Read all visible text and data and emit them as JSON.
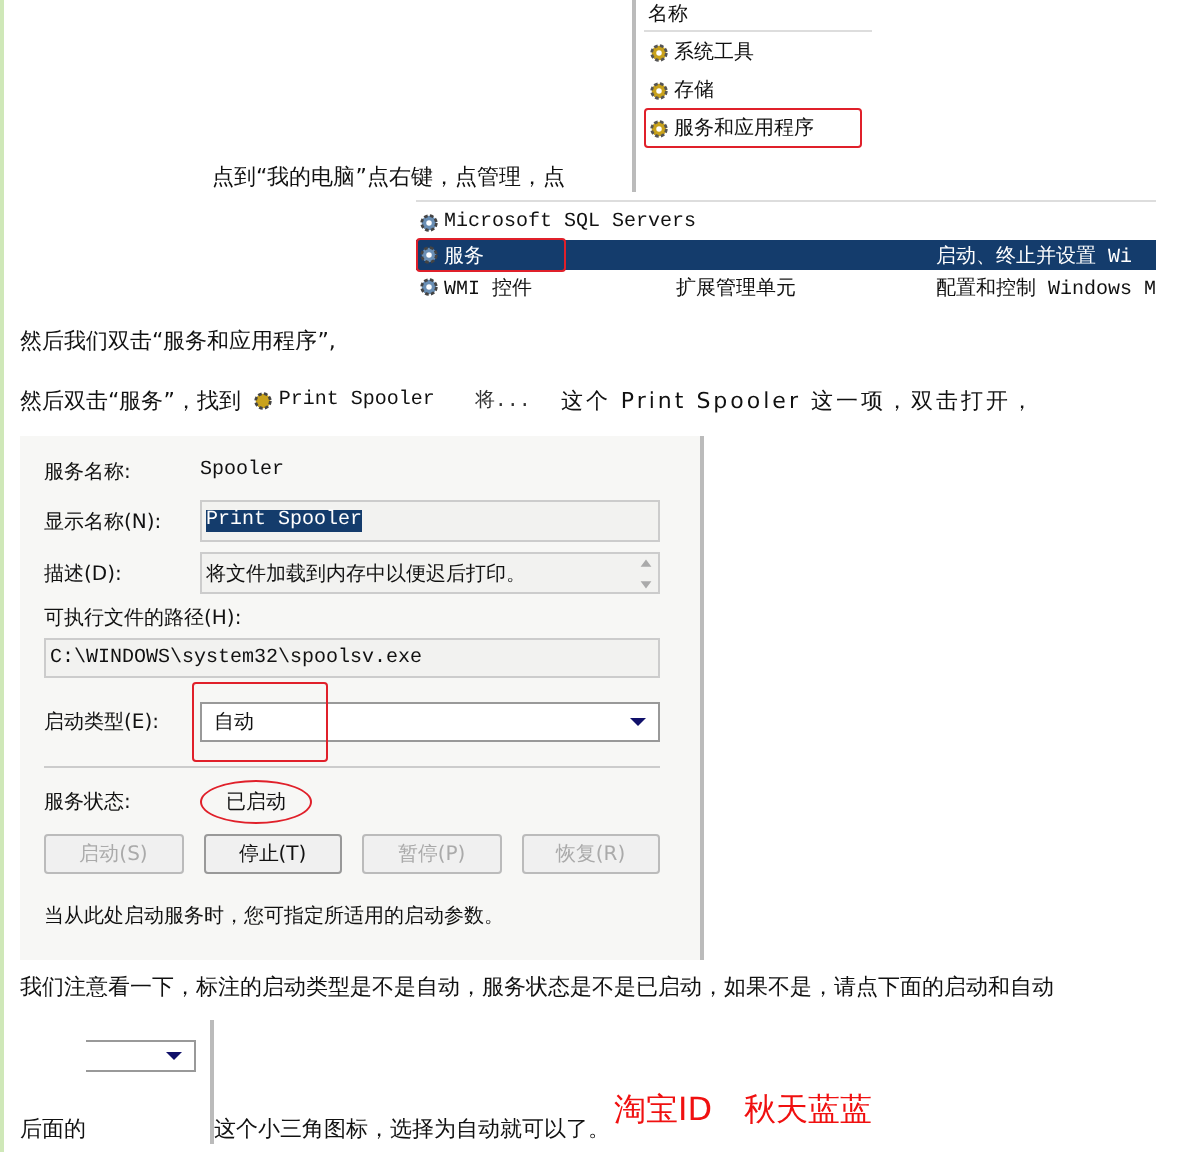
{
  "intro_line": "点到“我的电脑”点右键，点管理，点",
  "tree_shot": {
    "header": "名称",
    "items": [
      {
        "label": "系统工具",
        "highlighted": false
      },
      {
        "label": "存储",
        "highlighted": false
      },
      {
        "label": "服务和应用程序",
        "highlighted": true
      }
    ]
  },
  "services_shot": {
    "rows": [
      {
        "name": "Microsoft SQL Servers",
        "selected": false,
        "highlighted": false
      },
      {
        "name": "服务",
        "description": "启动、终止并设置 Wi",
        "selected": true,
        "highlighted": true
      },
      {
        "name": "WMI 控件",
        "type": "扩展管理单元",
        "description": "配置和控制 Windows M",
        "selected": false,
        "highlighted": false
      }
    ]
  },
  "step1": "然后我们双击“服务和应用程序”,",
  "step2": {
    "before": "然后双击“服务”，找到",
    "snippet": {
      "name": "Print Spooler",
      "column_2": "将..."
    },
    "after": "这个 Print Spooler 这一项，双击打开，"
  },
  "dialog": {
    "service_name": {
      "label": "服务名称:",
      "value": "Spooler"
    },
    "display_name": {
      "label": "显示名称(N):",
      "value": "Print Spooler",
      "text_selected": true
    },
    "description": {
      "label": "描述(D):",
      "value": "将文件加载到内存中以便迟后打印。"
    },
    "path": {
      "label": "可执行文件的路径(H):",
      "value": "C:\\WINDOWS\\system32\\spoolsv.exe"
    },
    "startup_type": {
      "label": "启动类型(E):",
      "value": "自动",
      "highlighted": true
    },
    "status": {
      "label": "服务状态:",
      "value": "已启动",
      "highlighted": true
    },
    "buttons": [
      {
        "label": "启动(S)",
        "disabled": true
      },
      {
        "label": "停止(T)",
        "disabled": false
      },
      {
        "label": "暂停(P)",
        "disabled": true
      },
      {
        "label": "恢复(R)",
        "disabled": true
      }
    ],
    "hint": "当从此处启动服务时，您可指定所适用的启动参数。"
  },
  "note": "我们注意看一下，标注的启动类型是不是自动，服务状态是不是已启动，如果不是，请点下面的启动和自动",
  "last_line": {
    "before": "后面的",
    "after": "这个小三角图标，选择为自动就可以了。",
    "signature": "淘宝ID　秋天蓝蓝"
  }
}
